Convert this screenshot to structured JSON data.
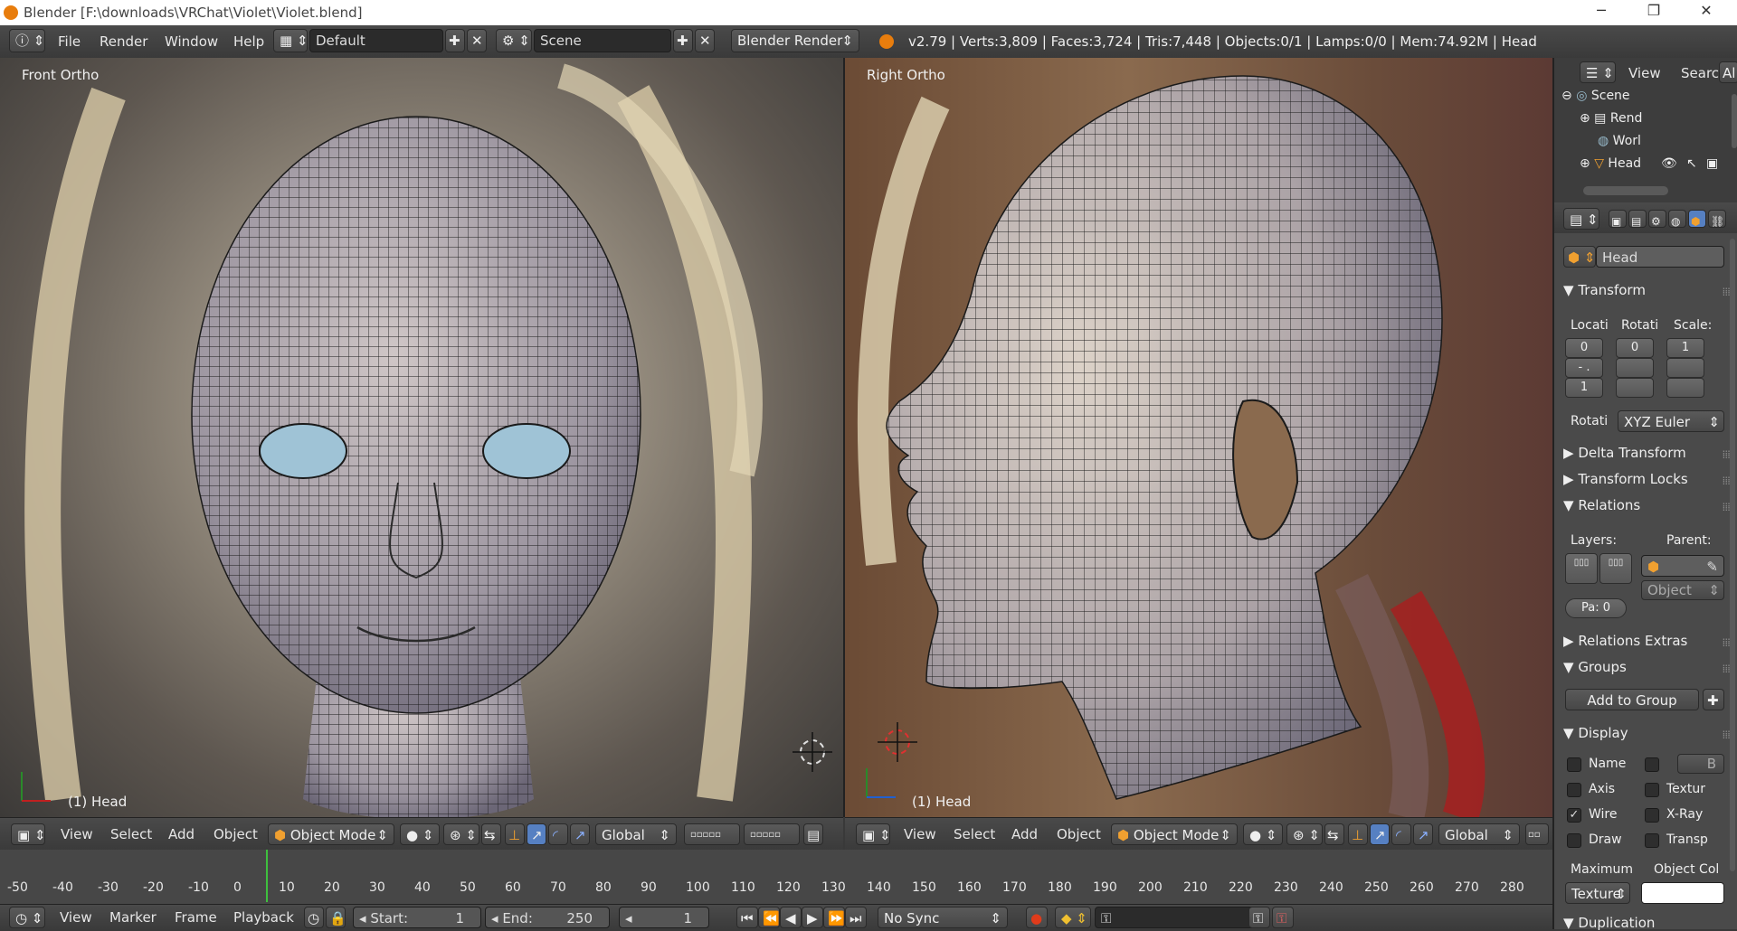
{
  "window": {
    "title": "Blender [F:\\downloads\\VRChat\\Violet\\Violet.blend]",
    "minimize": "─",
    "restore": "❐",
    "close": "✕"
  },
  "menus": [
    "File",
    "Render",
    "Window",
    "Help"
  ],
  "layout_name": "Default",
  "scene_name": "Scene",
  "render_engine": "Blender Render",
  "stats": "v2.79 | Verts:3,809 | Faces:3,724 | Tris:7,448 | Objects:0/1 | Lamps:0/0 | Mem:74.92M | Head",
  "viewports": {
    "left": {
      "label": "Front Ortho",
      "object": "(1) Head"
    },
    "right": {
      "label": "Right Ortho",
      "object": "(1) Head"
    }
  },
  "view_header": {
    "view": "View",
    "select": "Select",
    "add": "Add",
    "object": "Object",
    "mode": "Object Mode",
    "orientation": "Global"
  },
  "timeline": {
    "ticks": [
      "-50",
      "-40",
      "-30",
      "-20",
      "-10",
      "0",
      "10",
      "20",
      "30",
      "40",
      "50",
      "60",
      "70",
      "80",
      "90",
      "100",
      "110",
      "120",
      "130",
      "140",
      "150",
      "160",
      "170",
      "180",
      "190",
      "200",
      "210",
      "220",
      "230",
      "240",
      "250",
      "260",
      "270",
      "280"
    ],
    "menus": [
      "View",
      "Marker",
      "Frame",
      "Playback"
    ],
    "start_label": "Start:",
    "start": "1",
    "end_label": "End:",
    "end": "250",
    "current": "1",
    "sync": "No Sync"
  },
  "outliner": {
    "view": "View",
    "search": "Search",
    "all": "Al",
    "items": [
      "Scene",
      "Rend",
      "Worl",
      "Head"
    ]
  },
  "properties": {
    "object_name": "Head",
    "transform": "Transform",
    "location": "Locati",
    "rotation": "Rotati",
    "scale": "Scale:",
    "loc_val": "0",
    "rot_val": "0",
    "scale_val": "1",
    "loc_dash": "- .",
    "loc_val2": "1",
    "rotation_mode_label": "Rotati",
    "rotation_mode": "XYZ Euler",
    "delta_transform": "Delta Transform",
    "transform_locks": "Transform Locks",
    "relations": "Relations",
    "layers": "Layers:",
    "parent": "Parent:",
    "parent_type": "Object",
    "pass_index": "Pa: 0",
    "relations_extras": "Relations Extras",
    "groups": "Groups",
    "add_to_group": "Add to Group",
    "display": "Display",
    "name": "Name",
    "axis": "Axis",
    "wire": "Wire",
    "draw": "Draw",
    "bounds": "B",
    "texture_space": "Textur",
    "xray": "X-Ray",
    "transparency": "Transp",
    "maximum": "Maximum",
    "object_color": "Object Col",
    "max_draw_type": "Texture",
    "duplication": "Duplication"
  }
}
